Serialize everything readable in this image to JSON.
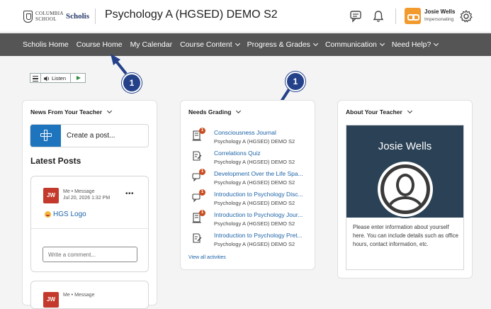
{
  "header": {
    "logo_school": "COLUMBIA SCHOOL",
    "logo_brand": "Scholis",
    "course_title": "Psychology A (HGSED) DEMO S2",
    "user_name": "Josie Wells",
    "user_status": "Impersonating",
    "icons": [
      "messages-icon",
      "notifications-icon",
      "settings-icon"
    ]
  },
  "nav": {
    "items": [
      {
        "label": "Scholis Home",
        "dropdown": false
      },
      {
        "label": "Course Home",
        "dropdown": false
      },
      {
        "label": "My Calendar",
        "dropdown": false
      },
      {
        "label": "Course Content",
        "dropdown": true
      },
      {
        "label": "Progress & Grades",
        "dropdown": true
      },
      {
        "label": "Communication",
        "dropdown": true
      },
      {
        "label": "Need Help?",
        "dropdown": true
      }
    ]
  },
  "readspeaker": {
    "listen_label": "Listen"
  },
  "callouts": [
    "1",
    "1"
  ],
  "news": {
    "title": "News From Your Teacher",
    "create_post": "Create a post...",
    "latest_posts": "Latest Posts",
    "posts": [
      {
        "initials": "JW",
        "meta": "Me • Message",
        "date": "Jul 20, 2026 1:32 PM",
        "link": "HGS Logo",
        "comment_placeholder": "Write a comment..."
      },
      {
        "initials": "JW",
        "meta": "Me • Message"
      }
    ]
  },
  "grading": {
    "title": "Needs Grading",
    "items": [
      {
        "title": "Consciousness Journal",
        "course": "Psychology A (HGSED) DEMO S2",
        "icon": "journal-icon",
        "badge": "1"
      },
      {
        "title": "Correlations Quiz",
        "course": "Psychology A (HGSED) DEMO S2",
        "icon": "quiz-icon",
        "badge": ""
      },
      {
        "title": "Development Over the Life Spa...",
        "course": "Psychology A (HGSED) DEMO S2",
        "icon": "discussion-icon",
        "badge": "1"
      },
      {
        "title": "Introduction to Psychology Disc...",
        "course": "Psychology A (HGSED) DEMO S2",
        "icon": "discussion-icon",
        "badge": "1"
      },
      {
        "title": "Introduction to Psychology Jour...",
        "course": "Psychology A (HGSED) DEMO S2",
        "icon": "journal-icon",
        "badge": "1"
      },
      {
        "title": "Introduction to Psychology Pret...",
        "course": "Psychology A (HGSED) DEMO S2",
        "icon": "quiz-icon",
        "badge": ""
      }
    ],
    "view_all": "View all activities"
  },
  "about": {
    "title": "About Your Teacher",
    "name": "Josie Wells",
    "description": "Please enter information about yourself here. You can include details such as office hours, contact information, etc."
  },
  "colors": {
    "nav_bg": "#555555",
    "link": "#1e64a8",
    "accent_blue": "#1e74bd",
    "callout": "#24418a",
    "profile_bg": "#2b4256",
    "avatar_orange": "#f29a2e",
    "badge": "#c94b1e"
  }
}
